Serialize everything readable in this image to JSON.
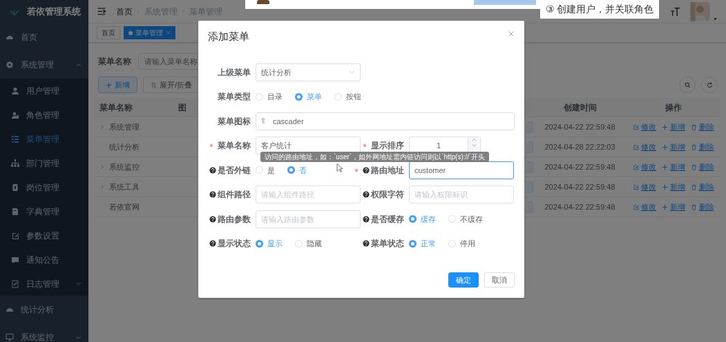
{
  "tutorial": {
    "callout": "③  创建用户，并关联角色"
  },
  "sidebar": {
    "title": "若依管理系统",
    "items": [
      {
        "label": "首页",
        "selected": false
      },
      {
        "label": "系统管理",
        "selected": false,
        "expanded": true,
        "children": [
          {
            "label": "用户管理",
            "selected": false
          },
          {
            "label": "角色管理",
            "selected": false
          },
          {
            "label": "菜单管理",
            "selected": true
          },
          {
            "label": "部门管理",
            "selected": false
          },
          {
            "label": "岗位管理",
            "selected": false
          },
          {
            "label": "字典管理",
            "selected": false
          },
          {
            "label": "参数设置",
            "selected": false
          },
          {
            "label": "通知公告",
            "selected": false
          },
          {
            "label": "日志管理",
            "selected": false,
            "expanded": false
          }
        ]
      },
      {
        "label": "统计分析",
        "selected": false
      },
      {
        "label": "系统监控",
        "selected": false,
        "expanded": false
      }
    ]
  },
  "header": {
    "breadcrumb": [
      "首页",
      "系统管理",
      "菜单管理"
    ]
  },
  "tabs": [
    {
      "label": "首页",
      "selected": false
    },
    {
      "label": "菜单管理",
      "selected": true
    }
  ],
  "search": {
    "label": "菜单名称",
    "placeholder": "请输入菜单名称"
  },
  "toolbar": {
    "buttons": [
      {
        "label": "新增",
        "kind": "primary"
      },
      {
        "label": "展开/折叠",
        "kind": "default"
      }
    ]
  },
  "table": {
    "columns": [
      "菜单名称",
      "图",
      "创建时间",
      "操作"
    ],
    "rows": [
      {
        "name": "系统管理",
        "expanded": false,
        "created": "2024-04-22 22:59:48",
        "actions": [
          "修改",
          "新增",
          "删除"
        ]
      },
      {
        "name": "统计分析",
        "created": "2024-04-28 22:22:03",
        "actions": [
          "修改",
          "新增",
          "删除"
        ]
      },
      {
        "name": "系统监控",
        "expanded": false,
        "created": "2024-04-22 22:59:48",
        "actions": [
          "修改",
          "新增",
          "删除"
        ]
      },
      {
        "name": "系统工具",
        "expanded": false,
        "created": "2024-04-22 22:59:48",
        "actions": [
          "修改",
          "新增",
          "删除"
        ]
      },
      {
        "name": "若依官网",
        "created": "2024-04-22 22:59:48",
        "actions": [
          "修改",
          "新增",
          "删除"
        ]
      }
    ]
  },
  "dialog": {
    "title": "添加菜单",
    "tooltip": "访问的路由地址，如：`user`，如外网地址需内链访问则以`http(s)://`开头",
    "rows": [
      [
        {
          "label": "上级菜单",
          "kind": "select",
          "value": "统计分析"
        }
      ],
      [
        {
          "label": "菜单类型",
          "kind": "radio",
          "options": [
            {
              "label": "目录",
              "selected": false
            },
            {
              "label": "菜单",
              "selected": true
            },
            {
              "label": "按钮",
              "selected": false
            }
          ]
        }
      ],
      [
        {
          "label": "菜单图标",
          "kind": "icon-input",
          "value": "cascader"
        }
      ],
      [
        {
          "label": "菜单名称",
          "kind": "input",
          "value": "客户统计",
          "focused": false,
          "required": true
        },
        {
          "label": "显示排序",
          "kind": "number",
          "value": "1",
          "required": true
        }
      ],
      [
        {
          "label": "是否外链",
          "kind": "radio",
          "help": true,
          "options": [
            {
              "label": "是",
              "selected": false
            },
            {
              "label": "否",
              "selected": true
            }
          ]
        },
        {
          "label": "路由地址",
          "kind": "input",
          "value": "customer",
          "focused": true,
          "required": true,
          "help": true
        }
      ],
      [
        {
          "label": "组件路径",
          "kind": "input",
          "placeholder": "请输入组件路径",
          "focused": false,
          "help": true
        },
        {
          "label": "权限字符",
          "kind": "input",
          "placeholder": "请输入权限标识",
          "focused": false,
          "help": true
        }
      ],
      [
        {
          "label": "路由参数",
          "kind": "input",
          "placeholder": "请输入路由参数",
          "focused": false,
          "help": true
        },
        {
          "label": "是否缓存",
          "kind": "radio",
          "help": true,
          "options": [
            {
              "label": "缓存",
              "selected": true
            },
            {
              "label": "不缓存",
              "selected": false
            }
          ]
        }
      ],
      [
        {
          "label": "显示状态",
          "kind": "radio",
          "help": true,
          "options": [
            {
              "label": "显示",
              "selected": true
            },
            {
              "label": "隐藏",
              "selected": false
            }
          ]
        },
        {
          "label": "菜单状态",
          "kind": "radio",
          "help": true,
          "options": [
            {
              "label": "正常",
              "selected": true
            },
            {
              "label": "停用",
              "selected": false
            }
          ]
        }
      ]
    ],
    "buttons": [
      {
        "label": "确定",
        "kind": "primary"
      },
      {
        "label": "取消",
        "kind": "default"
      }
    ]
  }
}
